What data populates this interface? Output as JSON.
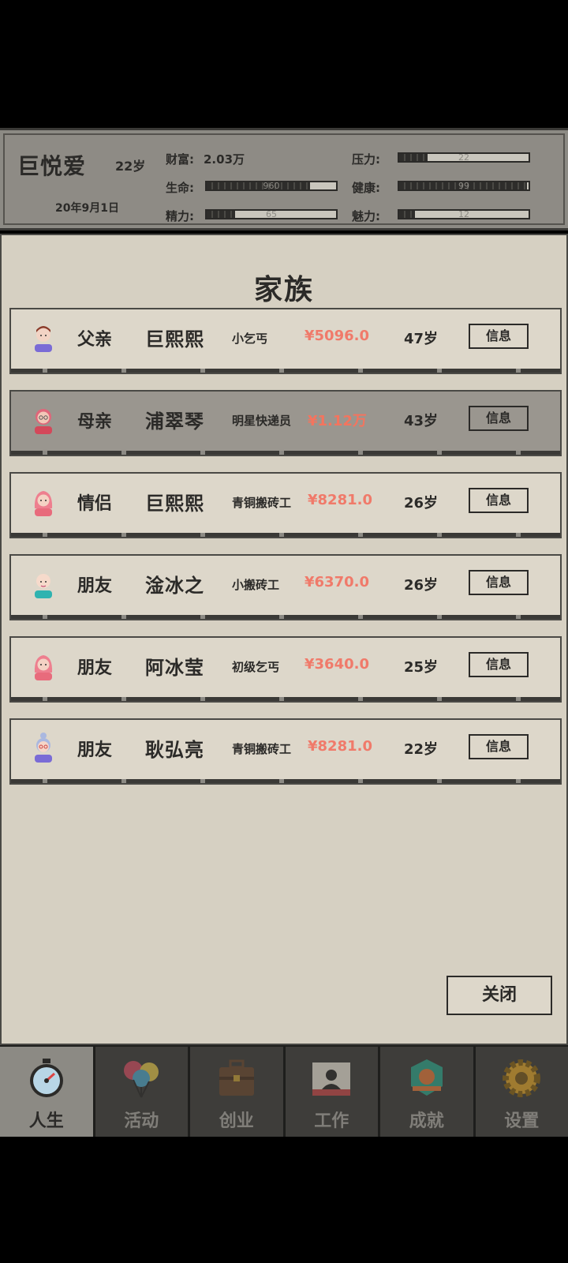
{
  "player": {
    "name": "巨悦爱",
    "age": "22岁",
    "date": "20年9月1日",
    "wealth_label": "财富:",
    "wealth_value": "2.03万"
  },
  "stats": {
    "life_label": "生命:",
    "life_value": "960",
    "life_fraction": 0.8,
    "energy_label": "精力:",
    "energy_value": "65",
    "energy_fraction": 0.22,
    "pressure_label": "压力:",
    "pressure_value": "22",
    "pressure_fraction": 0.22,
    "health_label": "健康:",
    "health_value": "99",
    "health_fraction": 0.99,
    "charm_label": "魅力:",
    "charm_value": "12",
    "charm_fraction": 0.12
  },
  "modal": {
    "title": "家族",
    "close_label": "关闭",
    "rows": [
      {
        "relation": "父亲",
        "name": "巨熙熙",
        "job": "小乞丐",
        "money": "¥5096.0",
        "age": "47岁",
        "button": "信息",
        "avatar": "male-avatar-icon"
      },
      {
        "relation": "母亲",
        "name": "浦翠琴",
        "job": "明星快递员",
        "money": "¥1.12万",
        "age": "43岁",
        "button": "信息",
        "avatar": "female-glasses-avatar-icon"
      },
      {
        "relation": "情侣",
        "name": "巨熙熙",
        "job": "青铜搬砖工",
        "money": "¥8281.0",
        "age": "26岁",
        "button": "信息",
        "avatar": "female-avatar-icon"
      },
      {
        "relation": "朋友",
        "name": "淦冰之",
        "job": "小搬砖工",
        "money": "¥6370.0",
        "age": "26岁",
        "button": "信息",
        "avatar": "bald-male-avatar-icon"
      },
      {
        "relation": "朋友",
        "name": "阿冰莹",
        "job": "初级乞丐",
        "money": "¥3640.0",
        "age": "25岁",
        "button": "信息",
        "avatar": "female-avatar-icon"
      },
      {
        "relation": "朋友",
        "name": "耿弘亮",
        "job": "青铜搬砖工",
        "money": "¥8281.0",
        "age": "22岁",
        "button": "信息",
        "avatar": "grandma-avatar-icon"
      }
    ]
  },
  "nav": {
    "tabs": [
      {
        "label": "人生",
        "icon": "stopwatch-icon"
      },
      {
        "label": "活动",
        "icon": "balloons-icon"
      },
      {
        "label": "创业",
        "icon": "briefcase-icon"
      },
      {
        "label": "工作",
        "icon": "id-card-icon"
      },
      {
        "label": "成就",
        "icon": "badge-icon"
      },
      {
        "label": "设置",
        "icon": "gear-icon"
      }
    ]
  },
  "colors": {
    "money": "#f07a6a",
    "panel_bg": "#d6d0c2",
    "status_bg": "#8c8a84",
    "selected_row": "#9a968f"
  }
}
